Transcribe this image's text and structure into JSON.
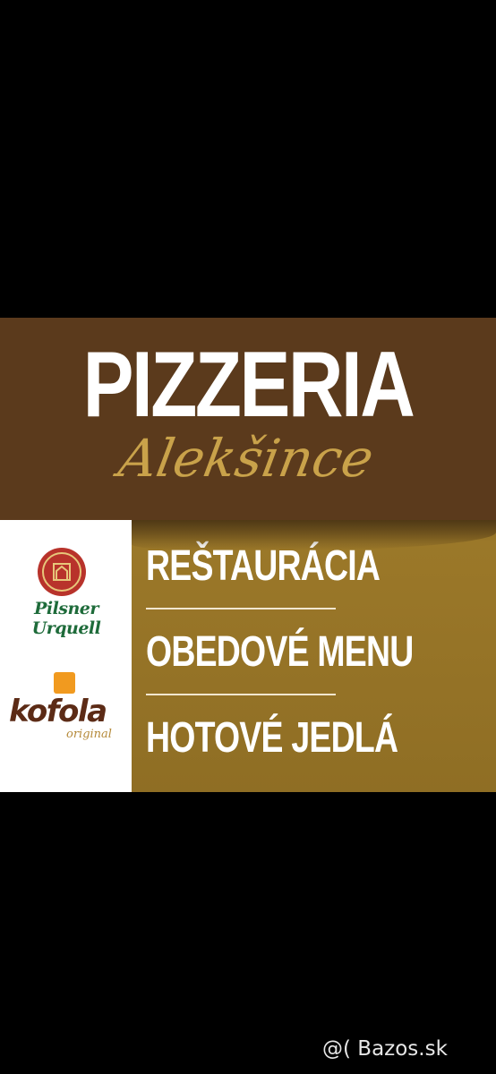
{
  "banner": {
    "title": "PIZZERIA",
    "subtitle": "Alekšince",
    "services": [
      {
        "label": "REŠTAURÁCIA"
      },
      {
        "label": "OBEDOVÉ MENU"
      },
      {
        "label": "HOTOVÉ JEDLÁ"
      }
    ],
    "logos": {
      "pilsner": "Pilsner Urquell",
      "kofola": "kofola",
      "kofola_sub": "original"
    }
  },
  "watermark": "@( Bazos.sk",
  "colors": {
    "background": "#000000",
    "brown_band": "#5b3a1c",
    "gold_panel": "#8f6e24",
    "gold_script": "#c9a24a",
    "pilsner_green": "#1e6b3a",
    "kofola_brown": "#5c2b16"
  }
}
